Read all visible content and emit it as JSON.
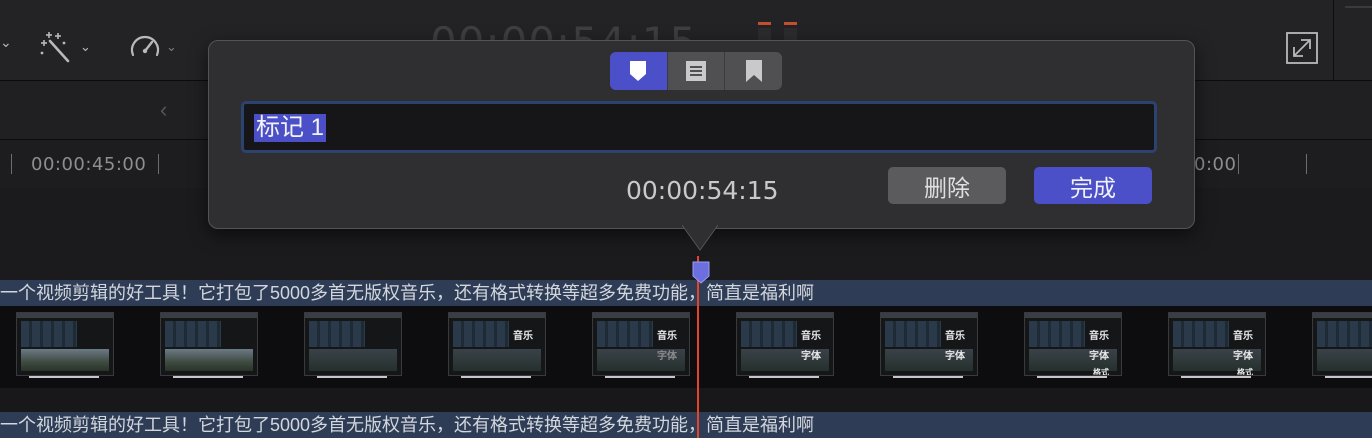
{
  "toolbar": {
    "faded_timecode": "00:00:54:15",
    "tools": [
      {
        "icon": "magic-wand-icon",
        "has_menu": true
      },
      {
        "icon": "speed-gauge-icon",
        "has_menu": true
      }
    ]
  },
  "ruler": {
    "left_label": "00:00:45:00",
    "right_label": "0:00"
  },
  "marker_popover": {
    "tabs": [
      {
        "icon": "marker-icon",
        "active": true
      },
      {
        "icon": "todo-list-icon",
        "active": false
      },
      {
        "icon": "chapter-bookmark-icon",
        "active": false
      }
    ],
    "name_value": "标记 1",
    "timecode": "00:00:54:15",
    "delete_label": "删除",
    "done_label": "完成"
  },
  "timeline": {
    "caption_text": "一个视频剪辑的好工具！它打包了5000多首无版权音乐，还有格式转换等超多免费功能，简直是福利啊",
    "caption_text_2": "一个视频剪辑的好工具！它打包了5000多首无版权音乐，还有格式转换等超多免费功能，简直是福利啊",
    "thumb_words": {
      "music": "音乐",
      "font": "字体",
      "format": "格式"
    }
  },
  "colors": {
    "accent": "#4b50c8",
    "playhead": "#e3442b",
    "caption_bar": "#2e3d55",
    "popover_bg": "#2f2f31"
  }
}
